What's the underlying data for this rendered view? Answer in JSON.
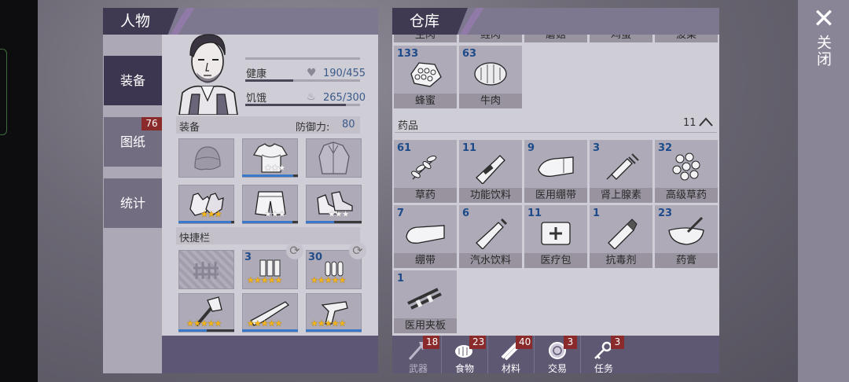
{
  "app": {
    "close_label": "关闭",
    "close_glyph": "✕"
  },
  "character": {
    "title": "人物",
    "tabs": [
      {
        "label": "装备",
        "active": true
      },
      {
        "label": "图纸",
        "badge": "76"
      },
      {
        "label": "统计"
      }
    ],
    "stats": {
      "health": {
        "label": "健康",
        "value": "190/455",
        "fraction": 0.42
      },
      "hunger": {
        "label": "饥饿",
        "value": "265/300",
        "fraction": 0.88
      }
    },
    "equipment": {
      "label": "装备",
      "defense_label": "防御力:",
      "defense_value": "80",
      "slots": [
        {
          "icon": "helmet-icon",
          "stars": "",
          "star_color": "",
          "durability": 0
        },
        {
          "icon": "tshirt-icon",
          "stars": "★★★",
          "star_color": "white",
          "durability": 0.92
        },
        {
          "icon": "jacket-icon",
          "stars": "",
          "star_color": "",
          "durability": 0
        },
        {
          "icon": "gloves-icon",
          "stars": "★★★",
          "star_color": "gold",
          "durability": 0.95
        },
        {
          "icon": "shorts-icon",
          "stars": "★★★",
          "star_color": "white",
          "durability": 0.9
        },
        {
          "icon": "shoes-icon",
          "stars": "★★★",
          "star_color": "white",
          "durability": 0.5
        }
      ]
    },
    "quickbar": {
      "label": "快捷栏",
      "slots": [
        {
          "icon": "locked-fence-icon",
          "count": "",
          "stars": ""
        },
        {
          "icon": "ammo-shells-icon",
          "count": "3",
          "stars": "★★★★★"
        },
        {
          "icon": "ammo-bullets-icon",
          "count": "30",
          "stars": "★★★★★"
        },
        {
          "icon": "axe-icon",
          "count": "",
          "stars": "★★★★★"
        },
        {
          "icon": "shotgun-icon",
          "count": "",
          "stars": "★★★★★"
        },
        {
          "icon": "revolver-icon",
          "count": "",
          "stars": "★★★★★"
        }
      ]
    }
  },
  "warehouse": {
    "title": "仓库",
    "top_partial": [
      "生肉",
      "鲑肉",
      "蘑菇",
      "鸡蛋",
      "菠菜"
    ],
    "food_items": [
      {
        "count": "133",
        "name": "蜂蜜",
        "icon": "honeycomb-icon"
      },
      {
        "count": "63",
        "name": "牛肉",
        "icon": "beef-icon"
      }
    ],
    "medicine": {
      "label": "药品",
      "count": "11",
      "items": [
        {
          "count": "61",
          "name": "草药",
          "icon": "herb-icon"
        },
        {
          "count": "11",
          "name": "功能饮料",
          "icon": "energy-drink-icon"
        },
        {
          "count": "9",
          "name": "医用绷带",
          "icon": "medical-bandage-icon"
        },
        {
          "count": "3",
          "name": "肾上腺素",
          "icon": "syringe-icon"
        },
        {
          "count": "32",
          "name": "高级草药",
          "icon": "advanced-herb-icon"
        },
        {
          "count": "7",
          "name": "绷带",
          "icon": "bandage-icon"
        },
        {
          "count": "6",
          "name": "汽水饮料",
          "icon": "soda-icon"
        },
        {
          "count": "11",
          "name": "医疗包",
          "icon": "medkit-icon"
        },
        {
          "count": "1",
          "name": "抗毒剂",
          "icon": "antidote-icon"
        },
        {
          "count": "23",
          "name": "药膏",
          "icon": "ointment-icon"
        },
        {
          "count": "1",
          "name": "医用夹板",
          "icon": "splint-icon"
        }
      ]
    },
    "bottom_tabs": [
      {
        "label": "武器",
        "badge": "18",
        "icon": "axe-icon"
      },
      {
        "label": "食物",
        "badge": "23",
        "icon": "steak-icon"
      },
      {
        "label": "材料",
        "badge": "40",
        "icon": "planks-icon"
      },
      {
        "label": "交易",
        "badge": "3",
        "icon": "coin-icon"
      },
      {
        "label": "任务",
        "badge": "3",
        "icon": "key-icon"
      }
    ]
  },
  "colors": {
    "accent": "#3f3a52",
    "badge": "#8a2a2a",
    "count_blue": "#1d4b8a",
    "star_gold": "#f2b51e"
  }
}
